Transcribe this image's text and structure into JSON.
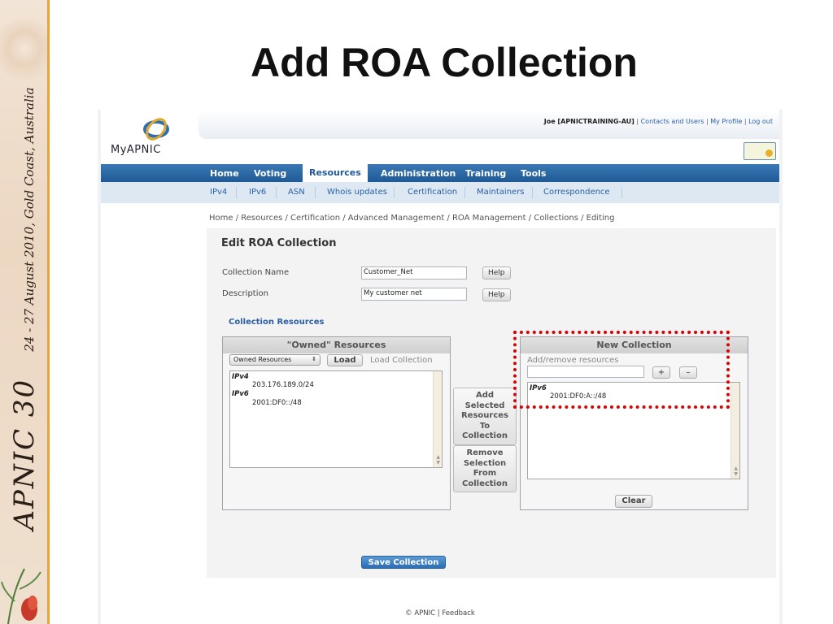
{
  "slide": {
    "title": "Add ROA Collection",
    "sidebar_main": "APNIC 30",
    "sidebar_sub": "24 - 27 August 2010, Gold Coast, Australia"
  },
  "app": {
    "logo_text": "MyAPNIC",
    "user": "Joe [APNICTRAINING-AU]",
    "links": [
      "Contacts and Users",
      "My Profile",
      "Log out"
    ],
    "nav": [
      "Home",
      "Voting",
      "Resources",
      "Administration",
      "Training",
      "Tools"
    ],
    "nav_active": "Resources",
    "subnav": [
      "IPv4",
      "IPv6",
      "ASN",
      "Whois updates",
      "Certification",
      "Maintainers",
      "Correspondence"
    ],
    "breadcrumb": "Home / Resources / Certification / Advanced Management / ROA Management / Collections / Editing",
    "page_title": "Edit ROA Collection",
    "form": {
      "collection_name_label": "Collection Name",
      "collection_name_value": "Customer_Net",
      "description_label": "Description",
      "description_value": "My customer net",
      "help_label": "Help"
    },
    "section_title": "Collection Resources",
    "owned": {
      "title": "\"Owned\" Resources",
      "select_value": "Owned Resources",
      "load_button": "Load",
      "load_collection": "Load Collection",
      "ipv4_header": "IPv4",
      "ipv4_item": "203.176.189.0/24",
      "ipv6_header": "IPv6",
      "ipv6_item": "2001:DF0::/48"
    },
    "add_button": "Add\nSelected\nResources\nTo\nCollection",
    "remove_button": "Remove\nSelection\nFrom\nCollection",
    "new_collection": {
      "title": "New Collection",
      "add_remove_label": "Add/remove resources",
      "plus": "+",
      "minus": "–",
      "ipv6_header": "IPv6",
      "ipv6_item": "2001:DF0:A::/48",
      "clear_button": "Clear"
    },
    "save_button": "Save Collection",
    "footer": "© APNIC | Feedback"
  },
  "colors": {
    "nav_blue": "#1f5a96",
    "link_blue": "#2b5fa8",
    "highlight_red": "#dd0000",
    "accent_orange": "#e8a33a"
  }
}
